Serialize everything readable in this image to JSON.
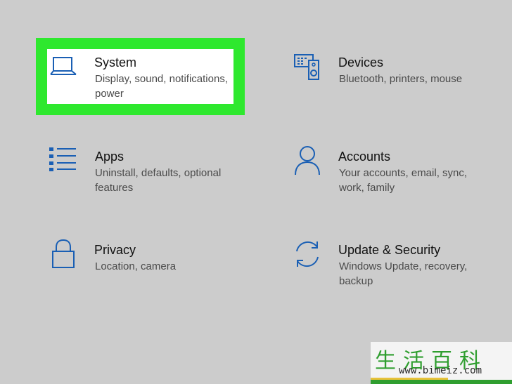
{
  "tiles": {
    "system": {
      "title": "System",
      "desc_line1": "Display, sound, notifications,",
      "desc_line2": "power",
      "icon": "laptop-icon"
    },
    "devices": {
      "title": "Devices",
      "desc_line1": "Bluetooth, printers, mouse",
      "icon": "devices-icon"
    },
    "apps": {
      "title": "Apps",
      "desc_line1": "Uninstall, defaults, optional",
      "desc_line2": "features",
      "icon": "apps-list-icon"
    },
    "accounts": {
      "title": "Accounts",
      "desc_line1": "Your accounts, email, sync,",
      "desc_line2": "work, family",
      "icon": "person-icon"
    },
    "privacy": {
      "title": "Privacy",
      "desc_line1": "Location, camera",
      "icon": "lock-icon"
    },
    "update": {
      "title": "Update & Security",
      "desc_line1": "Windows Update, recovery,",
      "desc_line2": "backup",
      "icon": "sync-icon"
    }
  },
  "colors": {
    "background": "#cccccc",
    "highlight": "#2ee82e",
    "icon_blue": "#1a5fb4"
  },
  "watermark": {
    "glyphs": "生活百科",
    "url": "www.bimeiz.com"
  }
}
